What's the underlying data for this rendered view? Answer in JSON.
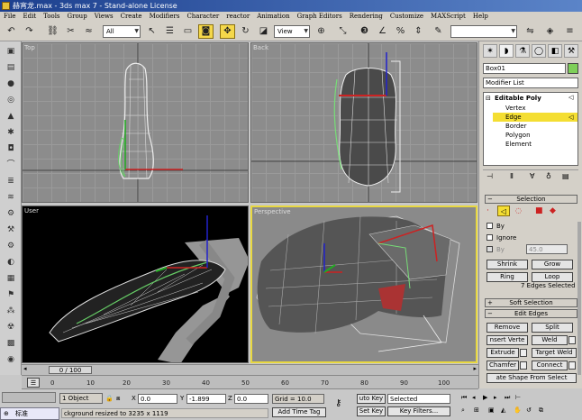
{
  "title": "赫宵龙.max - 3ds max 7 - Stand-alone License",
  "menu": [
    "File",
    "Edit",
    "Tools",
    "Group",
    "Views",
    "Create",
    "Modifiers",
    "Character",
    "reactor",
    "Animation",
    "Graph Editors",
    "Rendering",
    "Customize",
    "MAXScript",
    "Help"
  ],
  "toolbar": {
    "selection_filter": "All",
    "reference_coord": "View"
  },
  "viewports": {
    "top": "Top",
    "back": "Back",
    "user": "User",
    "perspective": "Perspective"
  },
  "panel": {
    "object_name": "Box01",
    "modifier_list": "Modifier List",
    "stack": {
      "root": "Editable Poly",
      "items": [
        "Vertex",
        "Edge",
        "Border",
        "Polygon",
        "Element"
      ],
      "selected": "Edge"
    },
    "selection": {
      "title": "Selection",
      "by": "By",
      "ignore": "Ignore",
      "by_angle": "By",
      "angle_value": "45.0",
      "shrink": "Shrink",
      "grow": "Grow",
      "ring": "Ring",
      "loop": "Loop",
      "status": "7 Edges Selected"
    },
    "soft_selection": "Soft Selection",
    "edit_edges": {
      "title": "Edit Edges",
      "remove": "Remove",
      "split": "Split",
      "insert_vertex": "nsert Verte",
      "weld": "Weld",
      "extrude": "Extrude",
      "target_weld": "Target Weld",
      "chamfer": "Chamfer",
      "connect": "Connect",
      "create_shape": "ate Shape From Select"
    }
  },
  "timeline": {
    "slider": "0 / 100"
  },
  "ruler": [
    "0",
    "10",
    "20",
    "30",
    "40",
    "50",
    "60",
    "70",
    "80",
    "90",
    "100"
  ],
  "status": {
    "selected": "1 Object",
    "x_label": "X",
    "x": "0.0",
    "y_label": "Y",
    "y": "-1.899",
    "z_label": "Z",
    "z": "0.0",
    "grid": "Grid = 10.0",
    "auto_key": "uto Key",
    "key_mode": "Selected",
    "set_key": "Set Key",
    "key_filters": "Key Filters...",
    "add_time_tag": "Add Time Tag",
    "prompt": "ckground resized to 3235 x 1119",
    "lang": "标准"
  }
}
